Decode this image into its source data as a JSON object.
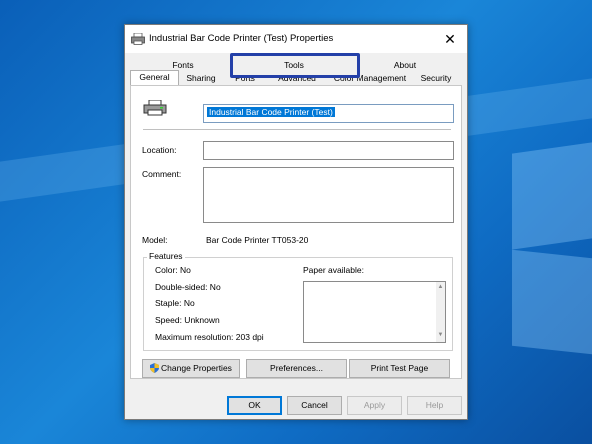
{
  "dialog": {
    "title": "Industrial Bar Code Printer (Test) Properties",
    "close_glyph": "✕"
  },
  "tabs": {
    "row1": [
      "Fonts",
      "Tools",
      "About"
    ],
    "row2": [
      "General",
      "Sharing",
      "Ports",
      "Advanced",
      "Color Management",
      "Security"
    ],
    "active": "General"
  },
  "general": {
    "printer_name": "Industrial Bar Code Printer (Test)",
    "location_label": "Location:",
    "location_value": "",
    "comment_label": "Comment:",
    "comment_value": "",
    "model_label": "Model:",
    "model_value": "Bar Code Printer TT053-20",
    "features_title": "Features",
    "features": [
      "Color: No",
      "Double-sided: No",
      "Staple: No",
      "Speed: Unknown",
      "Maximum resolution: 203 dpi"
    ],
    "paper_label": "Paper available:"
  },
  "buttons": {
    "change_properties": "Change Properties",
    "preferences": "Preferences...",
    "print_test_page": "Print Test Page",
    "ok": "OK",
    "cancel": "Cancel",
    "apply": "Apply",
    "help": "Help"
  },
  "colors": {
    "highlight": "#2440a8",
    "selection": "#0078d7",
    "desktop": "#1a86d8"
  },
  "icons": {
    "title": "printer-icon",
    "shield": "uac-shield-icon"
  }
}
